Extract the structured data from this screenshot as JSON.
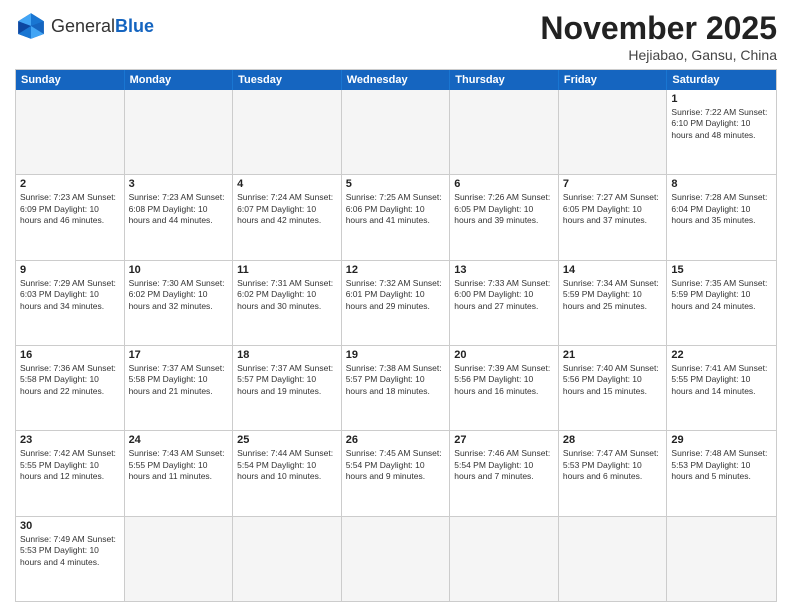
{
  "header": {
    "logo_general": "General",
    "logo_blue": "Blue",
    "month_title": "November 2025",
    "subtitle": "Hejiabao, Gansu, China"
  },
  "weekdays": [
    "Sunday",
    "Monday",
    "Tuesday",
    "Wednesday",
    "Thursday",
    "Friday",
    "Saturday"
  ],
  "weeks": [
    [
      {
        "day": "",
        "info": ""
      },
      {
        "day": "",
        "info": ""
      },
      {
        "day": "",
        "info": ""
      },
      {
        "day": "",
        "info": ""
      },
      {
        "day": "",
        "info": ""
      },
      {
        "day": "",
        "info": ""
      },
      {
        "day": "1",
        "info": "Sunrise: 7:22 AM\nSunset: 6:10 PM\nDaylight: 10 hours and 48 minutes."
      }
    ],
    [
      {
        "day": "2",
        "info": "Sunrise: 7:23 AM\nSunset: 6:09 PM\nDaylight: 10 hours and 46 minutes."
      },
      {
        "day": "3",
        "info": "Sunrise: 7:23 AM\nSunset: 6:08 PM\nDaylight: 10 hours and 44 minutes."
      },
      {
        "day": "4",
        "info": "Sunrise: 7:24 AM\nSunset: 6:07 PM\nDaylight: 10 hours and 42 minutes."
      },
      {
        "day": "5",
        "info": "Sunrise: 7:25 AM\nSunset: 6:06 PM\nDaylight: 10 hours and 41 minutes."
      },
      {
        "day": "6",
        "info": "Sunrise: 7:26 AM\nSunset: 6:05 PM\nDaylight: 10 hours and 39 minutes."
      },
      {
        "day": "7",
        "info": "Sunrise: 7:27 AM\nSunset: 6:05 PM\nDaylight: 10 hours and 37 minutes."
      },
      {
        "day": "8",
        "info": "Sunrise: 7:28 AM\nSunset: 6:04 PM\nDaylight: 10 hours and 35 minutes."
      }
    ],
    [
      {
        "day": "9",
        "info": "Sunrise: 7:29 AM\nSunset: 6:03 PM\nDaylight: 10 hours and 34 minutes."
      },
      {
        "day": "10",
        "info": "Sunrise: 7:30 AM\nSunset: 6:02 PM\nDaylight: 10 hours and 32 minutes."
      },
      {
        "day": "11",
        "info": "Sunrise: 7:31 AM\nSunset: 6:02 PM\nDaylight: 10 hours and 30 minutes."
      },
      {
        "day": "12",
        "info": "Sunrise: 7:32 AM\nSunset: 6:01 PM\nDaylight: 10 hours and 29 minutes."
      },
      {
        "day": "13",
        "info": "Sunrise: 7:33 AM\nSunset: 6:00 PM\nDaylight: 10 hours and 27 minutes."
      },
      {
        "day": "14",
        "info": "Sunrise: 7:34 AM\nSunset: 5:59 PM\nDaylight: 10 hours and 25 minutes."
      },
      {
        "day": "15",
        "info": "Sunrise: 7:35 AM\nSunset: 5:59 PM\nDaylight: 10 hours and 24 minutes."
      }
    ],
    [
      {
        "day": "16",
        "info": "Sunrise: 7:36 AM\nSunset: 5:58 PM\nDaylight: 10 hours and 22 minutes."
      },
      {
        "day": "17",
        "info": "Sunrise: 7:37 AM\nSunset: 5:58 PM\nDaylight: 10 hours and 21 minutes."
      },
      {
        "day": "18",
        "info": "Sunrise: 7:37 AM\nSunset: 5:57 PM\nDaylight: 10 hours and 19 minutes."
      },
      {
        "day": "19",
        "info": "Sunrise: 7:38 AM\nSunset: 5:57 PM\nDaylight: 10 hours and 18 minutes."
      },
      {
        "day": "20",
        "info": "Sunrise: 7:39 AM\nSunset: 5:56 PM\nDaylight: 10 hours and 16 minutes."
      },
      {
        "day": "21",
        "info": "Sunrise: 7:40 AM\nSunset: 5:56 PM\nDaylight: 10 hours and 15 minutes."
      },
      {
        "day": "22",
        "info": "Sunrise: 7:41 AM\nSunset: 5:55 PM\nDaylight: 10 hours and 14 minutes."
      }
    ],
    [
      {
        "day": "23",
        "info": "Sunrise: 7:42 AM\nSunset: 5:55 PM\nDaylight: 10 hours and 12 minutes."
      },
      {
        "day": "24",
        "info": "Sunrise: 7:43 AM\nSunset: 5:55 PM\nDaylight: 10 hours and 11 minutes."
      },
      {
        "day": "25",
        "info": "Sunrise: 7:44 AM\nSunset: 5:54 PM\nDaylight: 10 hours and 10 minutes."
      },
      {
        "day": "26",
        "info": "Sunrise: 7:45 AM\nSunset: 5:54 PM\nDaylight: 10 hours and 9 minutes."
      },
      {
        "day": "27",
        "info": "Sunrise: 7:46 AM\nSunset: 5:54 PM\nDaylight: 10 hours and 7 minutes."
      },
      {
        "day": "28",
        "info": "Sunrise: 7:47 AM\nSunset: 5:53 PM\nDaylight: 10 hours and 6 minutes."
      },
      {
        "day": "29",
        "info": "Sunrise: 7:48 AM\nSunset: 5:53 PM\nDaylight: 10 hours and 5 minutes."
      }
    ],
    [
      {
        "day": "30",
        "info": "Sunrise: 7:49 AM\nSunset: 5:53 PM\nDaylight: 10 hours and 4 minutes."
      },
      {
        "day": "",
        "info": ""
      },
      {
        "day": "",
        "info": ""
      },
      {
        "day": "",
        "info": ""
      },
      {
        "day": "",
        "info": ""
      },
      {
        "day": "",
        "info": ""
      },
      {
        "day": "",
        "info": ""
      }
    ]
  ]
}
